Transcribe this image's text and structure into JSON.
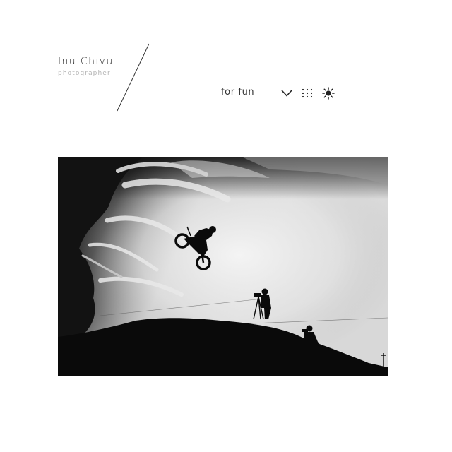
{
  "brand": {
    "name": "Inu Chivu",
    "tagline": "photographer"
  },
  "nav": {
    "current_label": "for fun",
    "dropdown_icon": "chevron-down-icon",
    "grid_icon": "grid-dots-icon",
    "theme_icon": "sun-icon"
  },
  "photo": {
    "style": "black-and-white silhouette",
    "colors": {
      "dark": "#0d0d0d",
      "light": "#e6e6e6"
    }
  }
}
